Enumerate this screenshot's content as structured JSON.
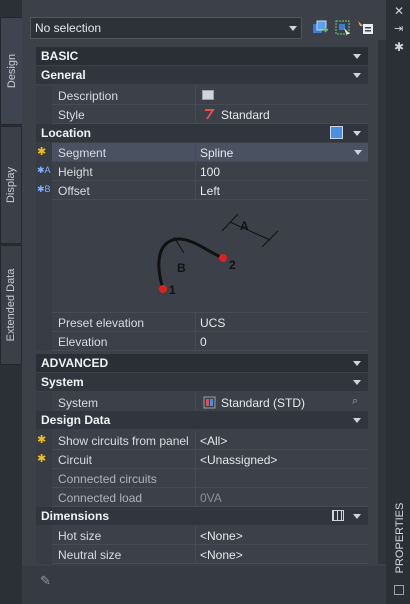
{
  "tabs": [
    {
      "label": "Design",
      "active": true
    },
    {
      "label": "Display",
      "active": false
    },
    {
      "label": "Extended Data",
      "active": false
    }
  ],
  "toolbar": {
    "selection_value": "No selection",
    "icons": [
      "add-object-icon",
      "select-objects-icon",
      "quick-select-icon"
    ]
  },
  "window_icons": [
    "close-icon",
    "auto-hide-icon",
    "settings-icon"
  ],
  "side_title": "PROPERTIES",
  "basic": {
    "label": "BASIC",
    "general": {
      "label": "General",
      "rows": [
        {
          "key": "Description",
          "value": ""
        },
        {
          "key": "Style",
          "value": "Standard"
        }
      ]
    },
    "location": {
      "label": "Location",
      "rows": [
        {
          "key": "Segment",
          "value": "Spline"
        },
        {
          "key": "Height",
          "value": "100"
        },
        {
          "key": "Offset",
          "value": "Left"
        }
      ],
      "diagram": {
        "label_a": "A",
        "label_b": "B",
        "label_1": "1",
        "label_2": "2"
      },
      "rows_after": [
        {
          "key": "Preset elevation",
          "value": "UCS"
        },
        {
          "key": "Elevation",
          "value": "0"
        }
      ]
    }
  },
  "advanced": {
    "label": "ADVANCED",
    "system": {
      "label": "System",
      "rows": [
        {
          "key": "System",
          "value": "Standard (STD)"
        }
      ]
    },
    "design_data": {
      "label": "Design Data",
      "rows": [
        {
          "key": "Show circuits from panel",
          "value": "<All>"
        },
        {
          "key": "Circuit",
          "value": "<Unassigned>"
        },
        {
          "key": "Connected circuits",
          "value": ""
        },
        {
          "key": "Connected load",
          "value": "0VA"
        }
      ]
    },
    "dimensions": {
      "label": "Dimensions",
      "rows": [
        {
          "key": "Hot size",
          "value": "<None>"
        },
        {
          "key": "Neutral size",
          "value": "<None>"
        }
      ]
    }
  },
  "colors": {
    "accent_star": "#f0c020",
    "spline": "#111111",
    "node": "#e02020"
  }
}
